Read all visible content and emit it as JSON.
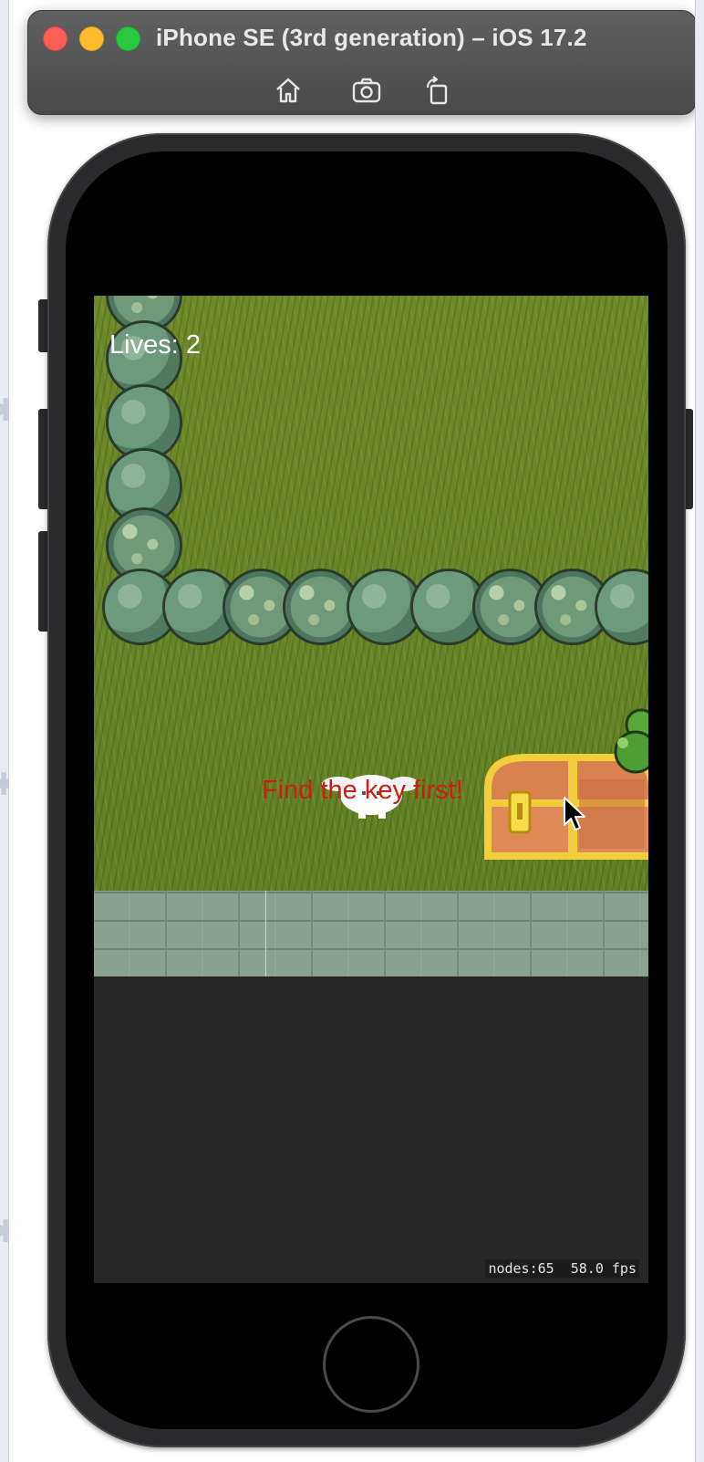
{
  "window": {
    "title": "iPhone SE (3rd generation) – iOS 17.2",
    "toolbar": [
      {
        "name": "home-icon"
      },
      {
        "name": "screenshot-icon"
      },
      {
        "name": "rotate-icon"
      }
    ]
  },
  "game": {
    "lives_label": "Lives: 2",
    "message": "Find the key first!",
    "message_color": "#d11a14"
  },
  "debug": {
    "nodes": "nodes:65",
    "fps": "58.0 fps"
  },
  "colors": {
    "grass": "#6f8a2c",
    "bush": "#6b9a7d",
    "stone": "#8aa391",
    "screen_background": "#262626"
  }
}
